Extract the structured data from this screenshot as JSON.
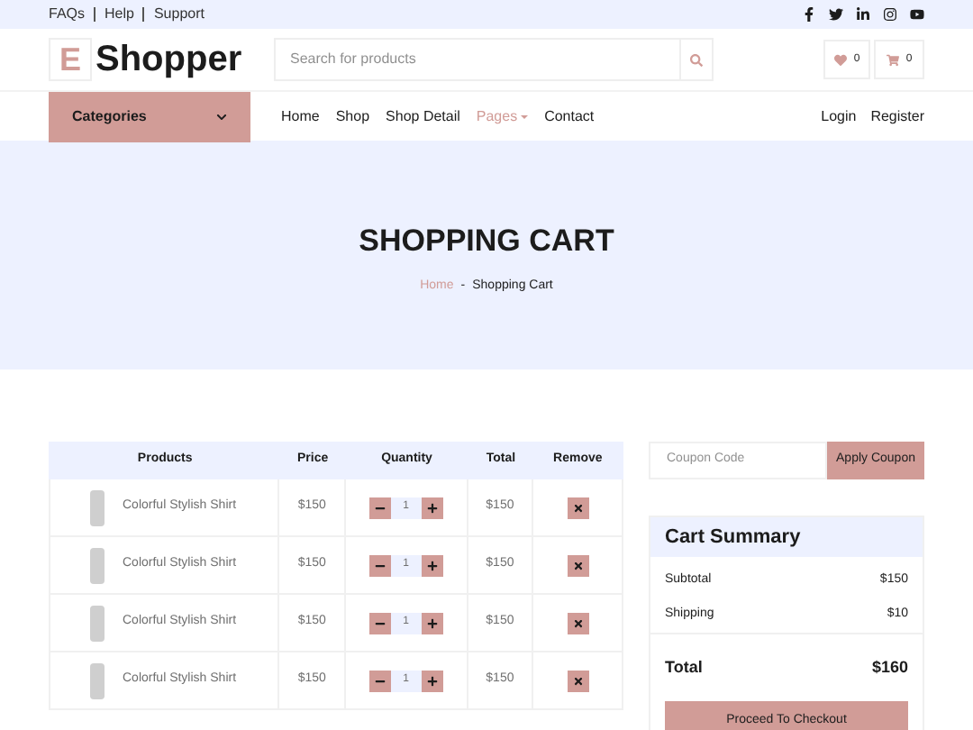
{
  "topbar": {
    "links": [
      "FAQs",
      "Help",
      "Support"
    ]
  },
  "header": {
    "logo_letter": "E",
    "logo_text": "Shopper",
    "search": {
      "placeholder": "Search for products"
    },
    "wishlist_count": "0",
    "cart_count": "0"
  },
  "nav": {
    "categories": "Categories",
    "links": [
      {
        "label": "Home",
        "selected": false,
        "dropdown": false
      },
      {
        "label": "Shop",
        "selected": false,
        "dropdown": false
      },
      {
        "label": "Shop Detail",
        "selected": false,
        "dropdown": false
      },
      {
        "label": "Pages",
        "selected": true,
        "dropdown": true
      },
      {
        "label": "Contact",
        "selected": false,
        "dropdown": false
      }
    ],
    "account": [
      "Login",
      "Register"
    ]
  },
  "hero": {
    "title": "SHOPPING CART",
    "breadcrumb": [
      "Home",
      "Shopping Cart"
    ],
    "separator": "-"
  },
  "table": {
    "columns": [
      "Products",
      "Price",
      "Quantity",
      "Total",
      "Remove"
    ],
    "rows": [
      {
        "product": "Colorful Stylish Shirt",
        "price": "$150",
        "quantity": "1",
        "total": "$150"
      },
      {
        "product": "Colorful Stylish Shirt",
        "price": "$150",
        "quantity": "1",
        "total": "$150"
      },
      {
        "product": "Colorful Stylish Shirt",
        "price": "$150",
        "quantity": "1",
        "total": "$150"
      },
      {
        "product": "Colorful Stylish Shirt",
        "price": "$150",
        "quantity": "1",
        "total": "$150"
      }
    ]
  },
  "coupon": {
    "placeholder": "Coupon Code",
    "button": "Apply Coupon"
  },
  "summary": {
    "title": "Cart Summary",
    "lines": [
      {
        "label": "Subtotal",
        "value": "$150"
      },
      {
        "label": "Shipping",
        "value": "$10"
      }
    ],
    "total_label": "Total",
    "total_value": "$160",
    "checkout": "Proceed To Checkout"
  }
}
